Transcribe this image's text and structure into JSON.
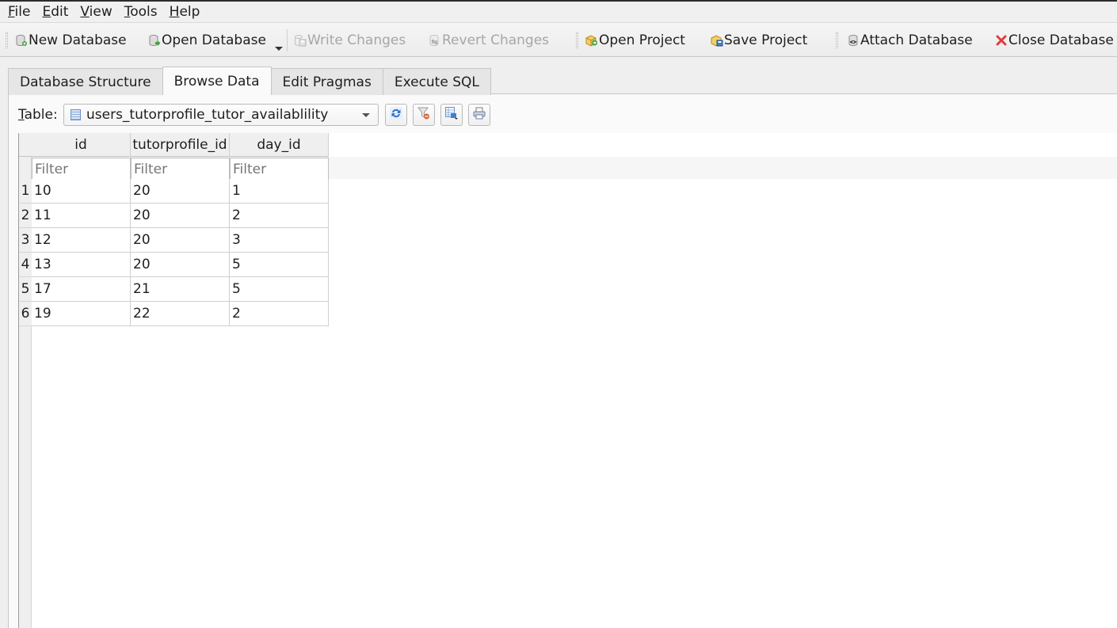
{
  "menubar": {
    "items": [
      {
        "label_u": "F",
        "label_rest": "ile"
      },
      {
        "label_u": "E",
        "label_rest": "dit"
      },
      {
        "label_u": "V",
        "label_rest": "iew"
      },
      {
        "label_u": "T",
        "label_rest": "ools"
      },
      {
        "label_u": "H",
        "label_rest": "elp"
      }
    ]
  },
  "toolbar": {
    "new_database": "New Database",
    "open_database": "Open Database",
    "write_changes": "Write Changes",
    "revert_changes": "Revert Changes",
    "open_project": "Open Project",
    "save_project": "Save Project",
    "attach_database": "Attach Database",
    "close_database": "Close Database"
  },
  "tabs": [
    {
      "label": "Database Structure",
      "active": false
    },
    {
      "label": "Browse Data",
      "active": true
    },
    {
      "label": "Edit Pragmas",
      "active": false
    },
    {
      "label": "Execute SQL",
      "active": false
    }
  ],
  "browse": {
    "table_label_u": "T",
    "table_label_rest": "able:",
    "selected_table": "users_tutorprofile_tutor_availablility",
    "filter_placeholder": "Filter",
    "columns": [
      "id",
      "tutorprofile_id",
      "day_id"
    ],
    "rows": [
      {
        "num": "1",
        "cells": [
          "10",
          "20",
          "1"
        ]
      },
      {
        "num": "2",
        "cells": [
          "11",
          "20",
          "2"
        ]
      },
      {
        "num": "3",
        "cells": [
          "12",
          "20",
          "3"
        ]
      },
      {
        "num": "4",
        "cells": [
          "13",
          "20",
          "5"
        ]
      },
      {
        "num": "5",
        "cells": [
          "17",
          "21",
          "5"
        ]
      },
      {
        "num": "6",
        "cells": [
          "19",
          "22",
          "2"
        ]
      }
    ]
  }
}
